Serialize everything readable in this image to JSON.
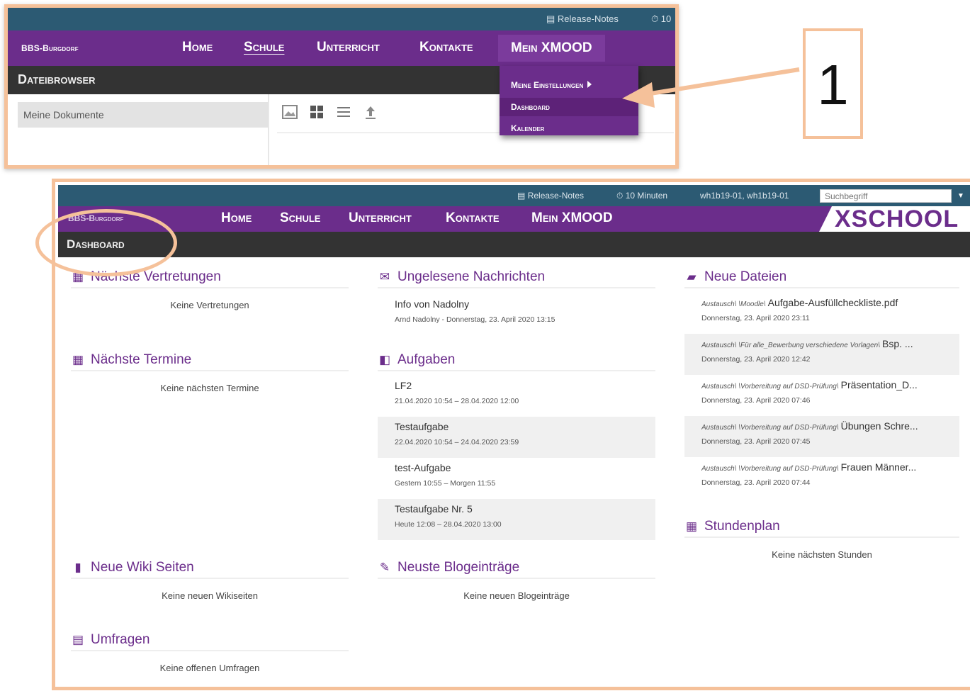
{
  "annotation": {
    "number": "1"
  },
  "shot1": {
    "topbar": {
      "release_notes": "Release-Notes",
      "timer": "10"
    },
    "nav": {
      "brand": "BBS-Burgdorf",
      "items": [
        "Home",
        "Schule",
        "Unterricht",
        "Kontakte",
        "Mein XMOOD"
      ]
    },
    "submenu": {
      "items": [
        "Meine Einstellungen",
        "Dashboard",
        "Kalender"
      ]
    },
    "subheader": "Dateibrowser",
    "sidebar": {
      "item": "Meine Dokumente"
    }
  },
  "shot2": {
    "topbar": {
      "release_notes": "Release-Notes",
      "timer": "10 Minuten",
      "users": "wh1b19-01, wh1b19-01",
      "search_placeholder": "Suchbegriff"
    },
    "nav": {
      "brand": "BBS-Burgdorf",
      "items": [
        "Home",
        "Schule",
        "Unterricht",
        "Kontakte",
        "Mein XMOOD"
      ],
      "logo": "XSCHOOL"
    },
    "subheader": "Dashboard",
    "panels": {
      "vertretungen": {
        "title": "Nächste Vertretungen",
        "empty": "Keine Vertretungen"
      },
      "termine": {
        "title": "Nächste Termine",
        "empty": "Keine nächsten Termine"
      },
      "wiki": {
        "title": "Neue Wiki Seiten",
        "empty": "Keine neuen Wikiseiten"
      },
      "umfragen": {
        "title": "Umfragen",
        "empty": "Keine offenen Umfragen"
      },
      "nachrichten": {
        "title": "Ungelesene Nachrichten",
        "items": [
          {
            "title": "Info von Nadolny",
            "meta": "Arnd Nadolny - Donnerstag, 23. April 2020 13:15"
          }
        ]
      },
      "aufgaben": {
        "title": "Aufgaben",
        "items": [
          {
            "title": "LF2",
            "meta": "21.04.2020 10:54 – 28.04.2020 12:00"
          },
          {
            "title": "Testaufgabe",
            "meta": "22.04.2020 10:54 – 24.04.2020 23:59"
          },
          {
            "title": "test-Aufgabe",
            "meta": "Gestern 10:55 – Morgen 11:55"
          },
          {
            "title": "Testaufgabe Nr. 5",
            "meta": "Heute 12:08 – 28.04.2020 13:00"
          }
        ]
      },
      "blog": {
        "title": "Neuste Blogeinträge",
        "empty": "Keine neuen Blogeinträge"
      },
      "dateien": {
        "title": "Neue Dateien",
        "items": [
          {
            "path": "Austausch\\ \\Moodle\\",
            "name": "Aufgabe-Ausfüllcheckliste.pdf",
            "meta": "Donnerstag, 23. April 2020 23:11"
          },
          {
            "path": "Austausch\\ \\Für alle_Bewerbung verschiedene Vorlagen\\",
            "name": "Bsp. ...",
            "meta": "Donnerstag, 23. April 2020 12:42"
          },
          {
            "path": "Austausch\\ \\Vorbereitung auf DSD-Prüfung\\",
            "name": "Präsentation_D...",
            "meta": "Donnerstag, 23. April 2020 07:46"
          },
          {
            "path": "Austausch\\ \\Vorbereitung auf DSD-Prüfung\\",
            "name": "Übungen Schre...",
            "meta": "Donnerstag, 23. April 2020 07:45"
          },
          {
            "path": "Austausch\\ \\Vorbereitung auf DSD-Prüfung\\",
            "name": "Frauen Männer...",
            "meta": "Donnerstag, 23. April 2020 07:44"
          }
        ]
      },
      "stundenplan": {
        "title": "Stundenplan",
        "empty": "Keine nächsten Stunden"
      }
    }
  },
  "icons": {
    "calendar": "calendar-icon",
    "envelope": "envelope-icon",
    "folder": "folder-open-icon",
    "tasks": "tasks-icon",
    "book": "book-icon",
    "poll": "poll-icon",
    "pin": "pin-icon",
    "clock": "clock-icon",
    "newspaper": "newspaper-icon"
  },
  "colors": {
    "nav_purple": "#6b2d8b",
    "topbar_teal": "#2c5a73",
    "subheader_dark": "#333333",
    "annotation_orange": "#f5c19a"
  }
}
